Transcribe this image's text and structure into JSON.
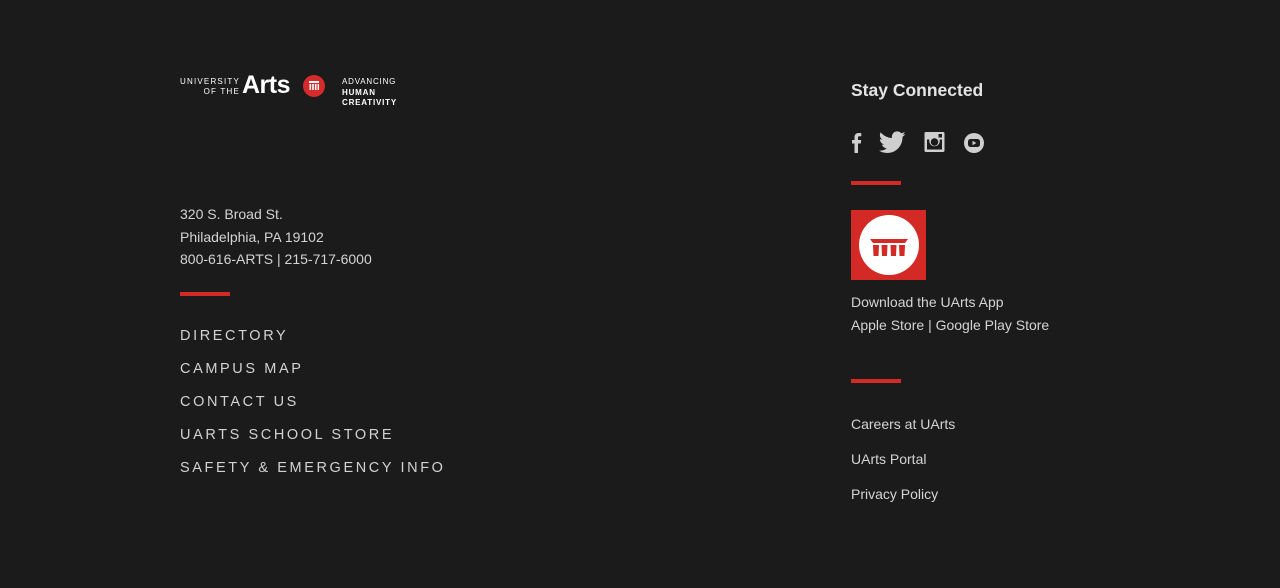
{
  "logo": {
    "university_line1": "UNIVERSITY",
    "university_line2": "OF THE",
    "arts": "Arts",
    "tagline_line1": "ADVANCING",
    "tagline_line2": "HUMAN",
    "tagline_line3": "CREATIVITY"
  },
  "address": {
    "street": "320 S. Broad St.",
    "city": "Philadelphia, PA 19102",
    "phones": "800-616-ARTS | 215-717-6000"
  },
  "nav": [
    {
      "label": "DIRECTORY"
    },
    {
      "label": "CAMPUS MAP"
    },
    {
      "label": "CONTACT US"
    },
    {
      "label": "UARTS SCHOOL STORE"
    },
    {
      "label": "SAFETY & EMERGENCY INFO"
    }
  ],
  "social": {
    "heading": "Stay Connected",
    "icons": [
      "facebook-icon",
      "twitter-icon",
      "instagram-icon",
      "youtube-icon"
    ]
  },
  "app": {
    "download_label": "Download the UArts App",
    "apple_label": "Apple Store",
    "separator": "|",
    "google_label": "Google Play Store"
  },
  "links": [
    {
      "label": "Careers at UArts"
    },
    {
      "label": "UArts Portal"
    },
    {
      "label": "Privacy Policy"
    }
  ],
  "colors": {
    "background": "#1b1b1b",
    "accent": "#d42a25",
    "text": "#d4d4d4"
  }
}
